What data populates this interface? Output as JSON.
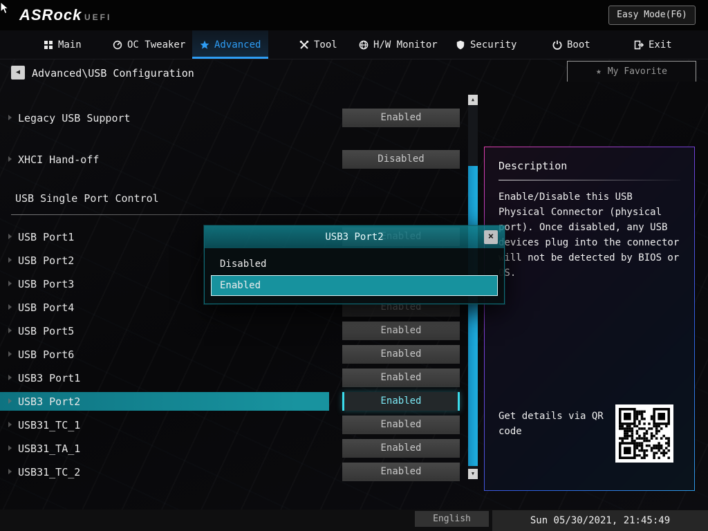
{
  "appearance": {
    "accent_blue": "#2e9df5",
    "highlight_teal": "#17929e",
    "scrollbar_blue": "#1fb0e2",
    "selected_value_cyan": "#7ce8f4"
  },
  "icons": {
    "back_arrow": "◀",
    "close": "×",
    "favorite_star": "★",
    "scroll_up": "▲",
    "scroll_down": "▼"
  },
  "header": {
    "logo_text": "ASRock",
    "logo_sub": "UEFI",
    "easy_mode_label": "Easy Mode(F6)"
  },
  "nav": {
    "tabs": [
      {
        "label": "Main",
        "active": false
      },
      {
        "label": "OC Tweaker",
        "active": false
      },
      {
        "label": "Advanced",
        "active": true
      },
      {
        "label": "Tool",
        "active": false
      },
      {
        "label": "H/W Monitor",
        "active": false
      },
      {
        "label": "Security",
        "active": false
      },
      {
        "label": "Boot",
        "active": false
      },
      {
        "label": "Exit",
        "active": false
      }
    ]
  },
  "breadcrumb": {
    "path": "Advanced\\USB Configuration"
  },
  "favorites": {
    "label": "My Favorite"
  },
  "settings": {
    "items": [
      {
        "type": "item",
        "label": "Legacy USB Support",
        "value": "Enabled"
      },
      {
        "type": "item",
        "label": "XHCI Hand-off",
        "value": "Disabled"
      },
      {
        "type": "section",
        "label": "USB Single Port Control"
      },
      {
        "type": "item",
        "label": "USB Port1",
        "value": "Enabled"
      },
      {
        "type": "item",
        "label": "USB Port2",
        "value": ""
      },
      {
        "type": "item",
        "label": "USB Port3",
        "value": ""
      },
      {
        "type": "item",
        "label": "USB Port4",
        "value": "Enabled",
        "dimmed": true
      },
      {
        "type": "item",
        "label": "USB Port5",
        "value": "Enabled"
      },
      {
        "type": "item",
        "label": "USB Port6",
        "value": "Enabled"
      },
      {
        "type": "item",
        "label": "USB3 Port1",
        "value": "Enabled"
      },
      {
        "type": "item",
        "label": "USB3 Port2",
        "value": "Enabled",
        "selected": true
      },
      {
        "type": "item",
        "label": "USB31_TC_1",
        "value": "Enabled"
      },
      {
        "type": "item",
        "label": "USB31_TA_1",
        "value": "Enabled"
      },
      {
        "type": "item",
        "label": "USB31_TC_2",
        "value": "Enabled"
      }
    ]
  },
  "popup": {
    "title": "USB3 Port2",
    "options": [
      {
        "label": "Disabled",
        "selected": false
      },
      {
        "label": "Enabled",
        "selected": true
      }
    ]
  },
  "description": {
    "title": "Description",
    "body": "Enable/Disable this USB Physical Connector (physical port).  Once disabled, any USB devices plug into the connector will not be detected by BIOS or OS.",
    "qr_label": "Get details via QR code"
  },
  "footer": {
    "language": "English",
    "datetime": "Sun 05/30/2021, 21:45:49"
  }
}
